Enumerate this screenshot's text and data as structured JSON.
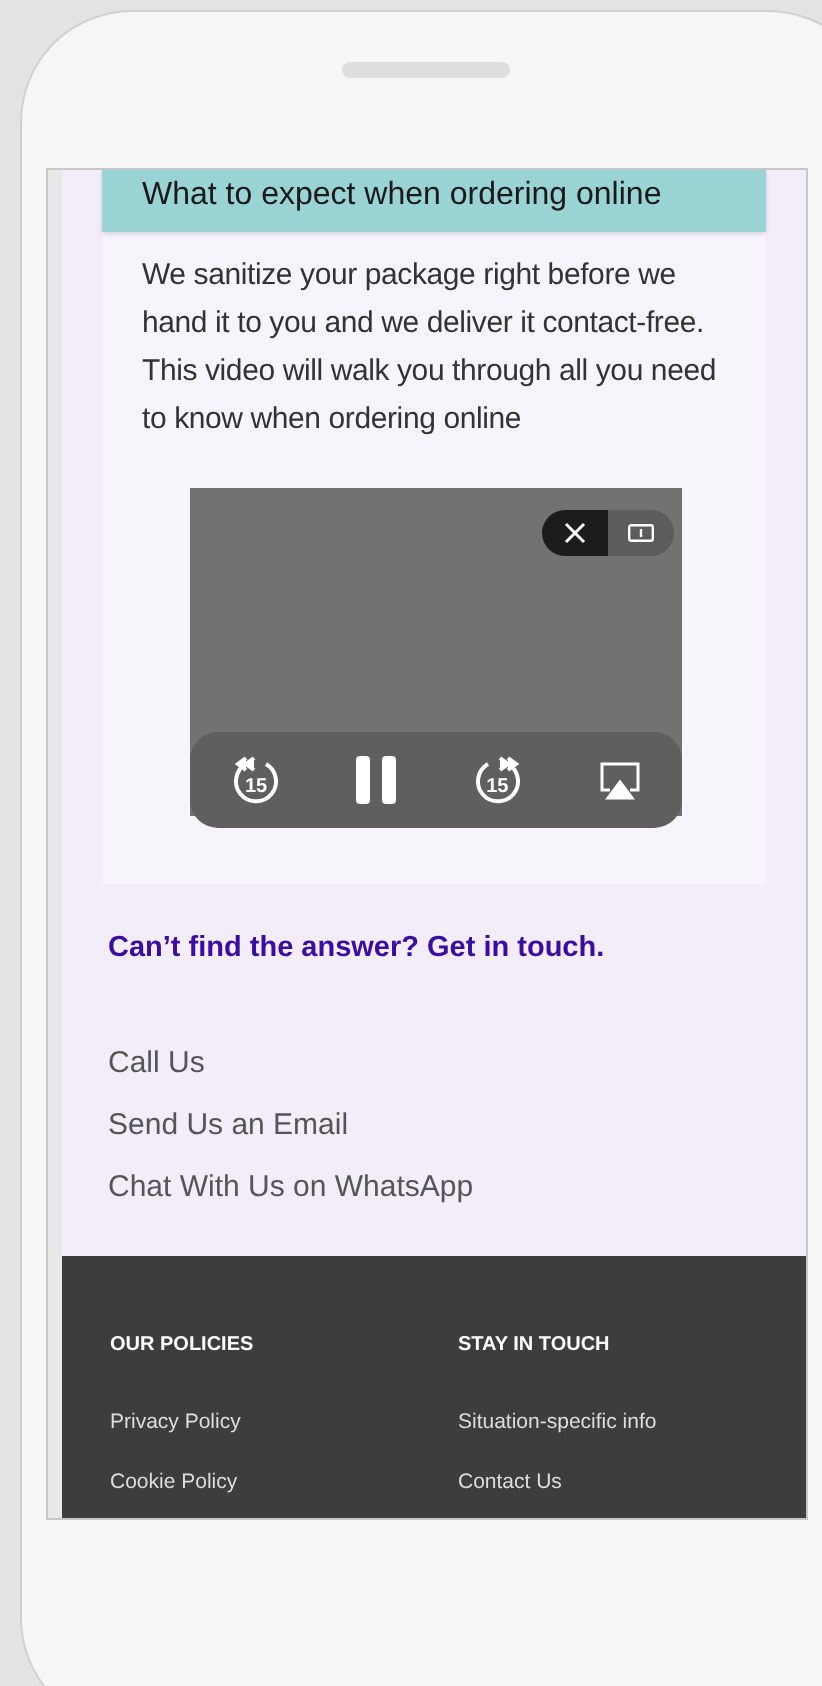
{
  "faq": {
    "title": "What to expect when ordering online",
    "body": "We sanitize your package right before we hand it to you and we deliver it contact-free. This video will walk you through all you need to know when ordering online",
    "video": {
      "skip_back": "15",
      "skip_forward": "15"
    }
  },
  "contact": {
    "heading": "Can’t find the answer? Get in touch.",
    "links": [
      "Call Us",
      "Send Us an Email",
      "Chat With Us on WhatsApp"
    ]
  },
  "footer": {
    "columns": [
      {
        "heading": "OUR POLICIES",
        "links": [
          "Privacy Policy",
          "Cookie Policy"
        ]
      },
      {
        "heading": "STAY IN TOUCH",
        "links": [
          "Situation-specific info",
          "Contact Us"
        ]
      }
    ]
  }
}
